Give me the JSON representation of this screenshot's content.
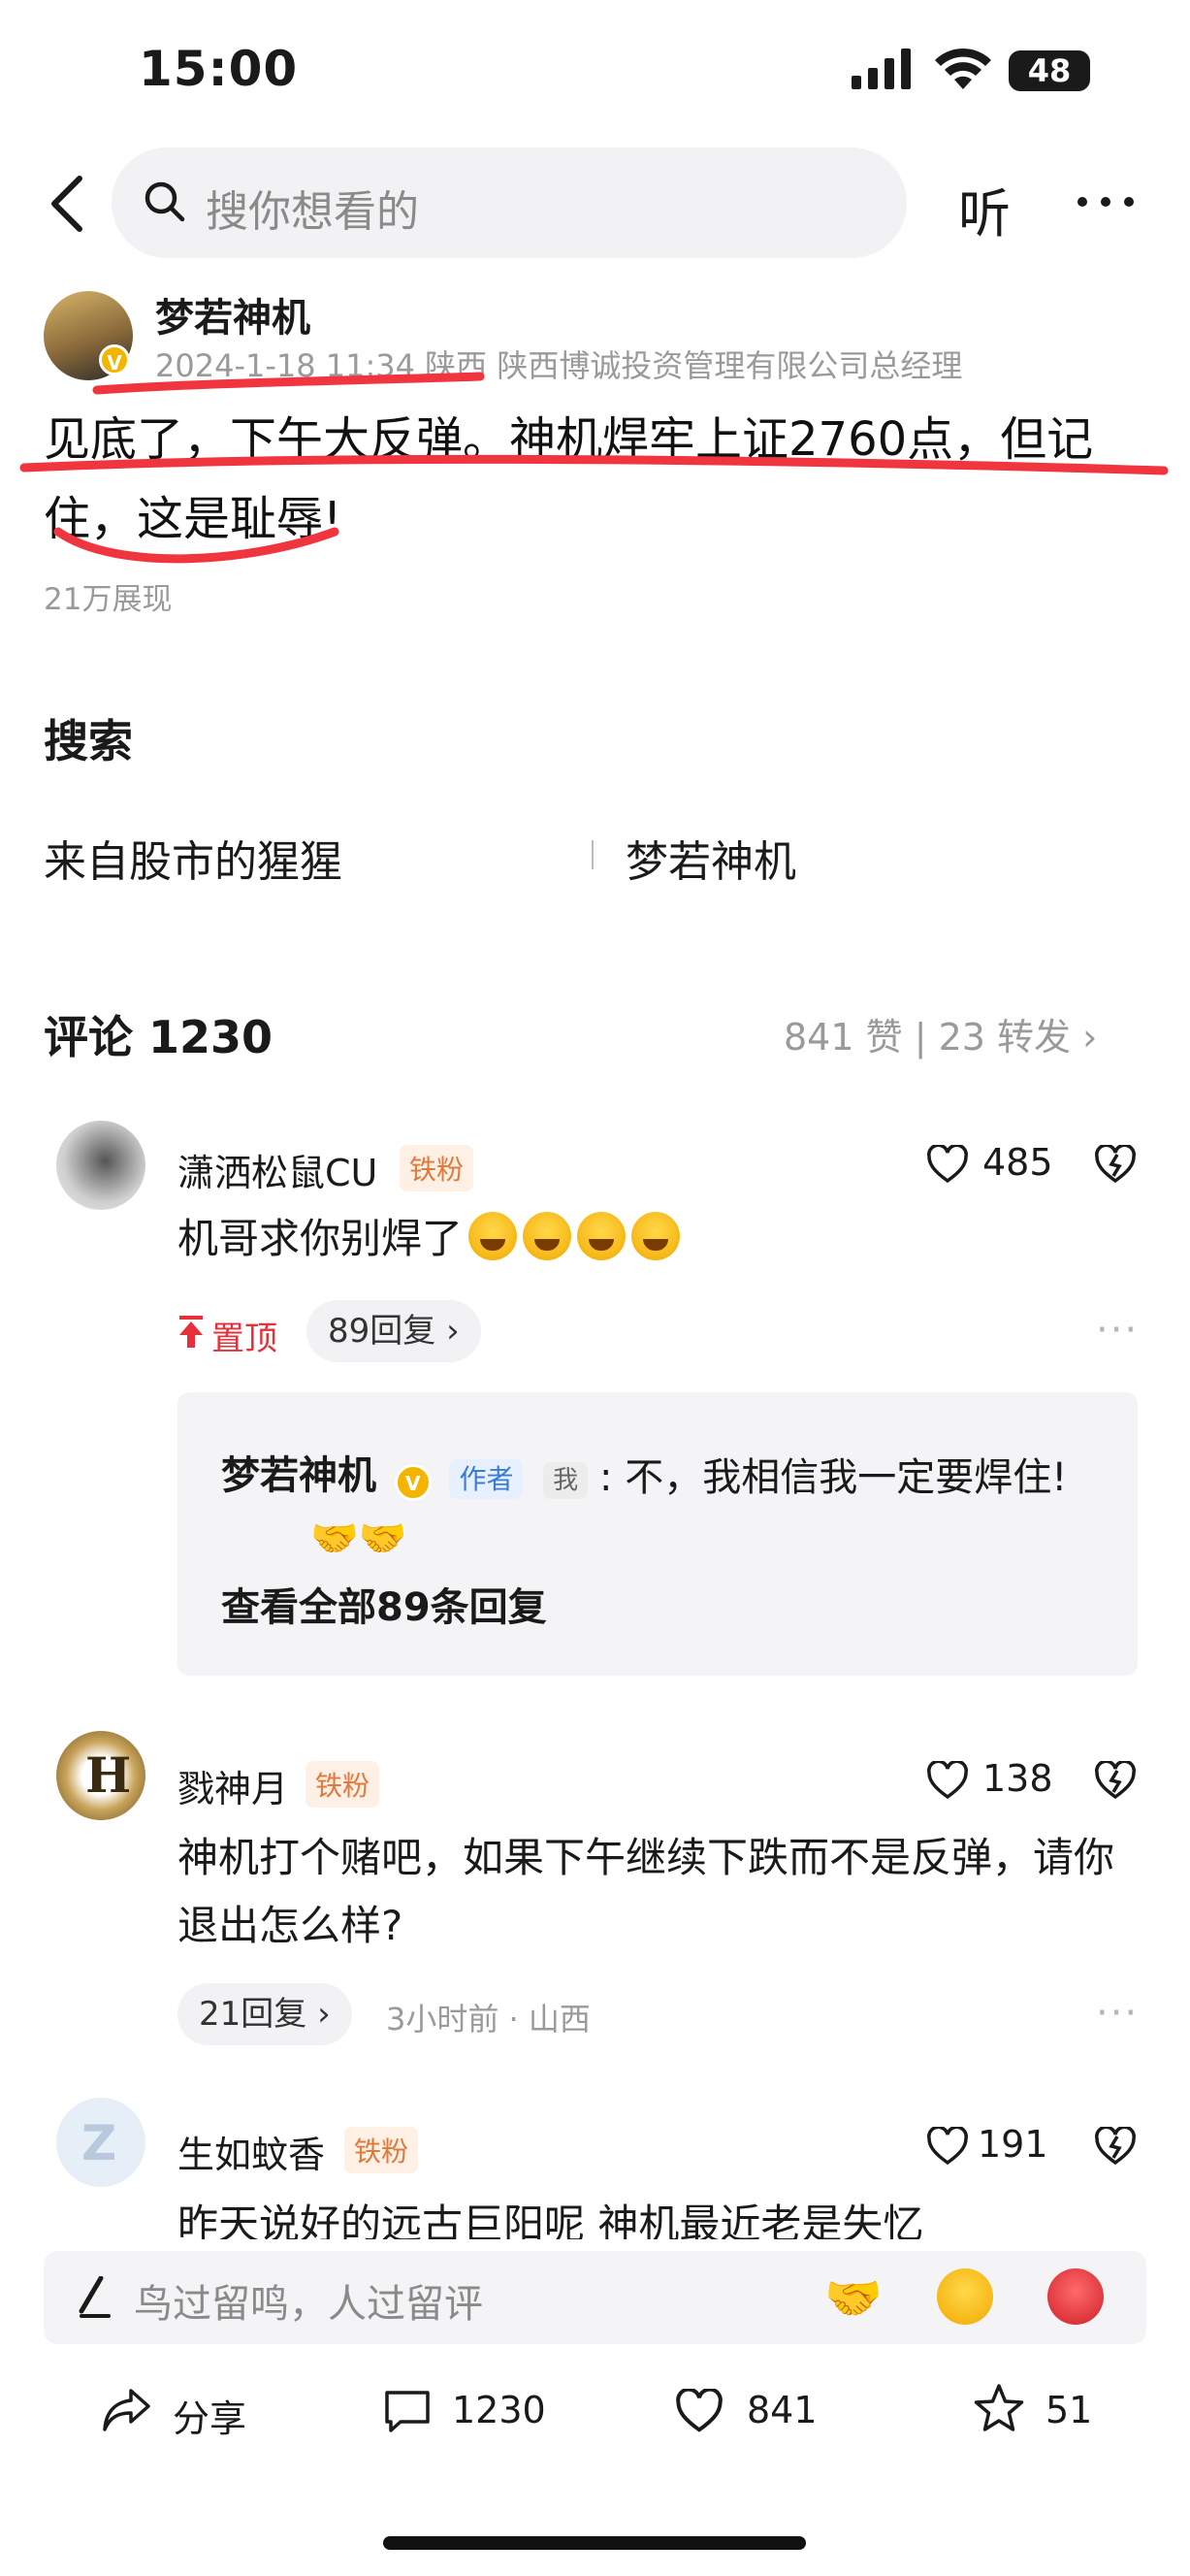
{
  "status_bar": {
    "time": "15:00",
    "battery": "48"
  },
  "search": {
    "placeholder": "搜你想看的",
    "listen_label": "听",
    "more": "···"
  },
  "post": {
    "author": "梦若神机",
    "meta": "2024-1-18 11:34 陕西  陕西博诚投资管理有限公司总经理",
    "text": "见底了，下午大反弹。神机焊牢上证2760点，但记住，这是耻辱!",
    "views": "21万展现",
    "verified": "V"
  },
  "search_section": {
    "title": "搜索",
    "tags": [
      "来自股市的猩猩",
      "梦若神机"
    ]
  },
  "comments_header": {
    "title": "评论 1230",
    "stats": "841 赞 | 23 转发"
  },
  "comments": [
    {
      "name": "潇洒松鼠CU",
      "badge": "铁粉",
      "likes": "485",
      "text": "机哥求你别焊了",
      "pinned": "置顶",
      "replies": "89回复",
      "more": "···",
      "reply": {
        "name": "梦若神机",
        "author_tag": "作者",
        "me_tag": "我",
        "text": ": 不，我相信我一定要焊住!",
        "view_all": "查看全部89条回复"
      }
    },
    {
      "name": "戮神月",
      "badge": "铁粉",
      "likes": "138",
      "text": "神机打个赌吧，如果下午继续下跌而不是反弹，请你退出怎么样?",
      "replies": "21回复",
      "time_loc": "3小时前 · 山西",
      "more": "···"
    },
    {
      "name": "生如蚊香",
      "badge": "铁粉",
      "likes": "191",
      "text": "昨天说好的远古巨阳呢 神机最近老是失忆"
    }
  ],
  "input": {
    "placeholder": "鸟过留鸣，人过留评"
  },
  "actions": {
    "share": "分享",
    "comments": "1230",
    "likes": "841",
    "favorites": "51"
  },
  "colors": {
    "accent_red": "#e8303a",
    "badge_orange": "#e07a3a",
    "author_blue": "#3a7bd5",
    "annotation": "#f0353f"
  }
}
